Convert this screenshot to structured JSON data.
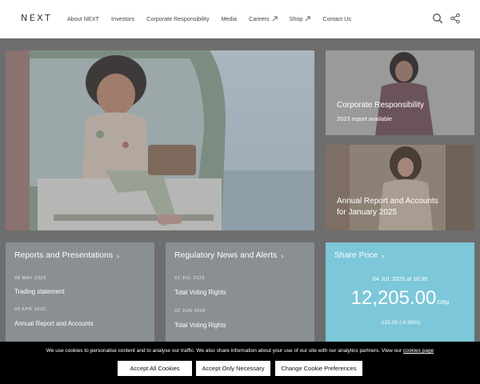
{
  "header": {
    "logo": "NEXT",
    "nav": [
      {
        "label": "About NEXT",
        "external": false
      },
      {
        "label": "Investors",
        "external": false
      },
      {
        "label": "Corporate Responsibility",
        "external": false
      },
      {
        "label": "Media",
        "external": false
      },
      {
        "label": "Careers",
        "external": true
      },
      {
        "label": "Shop",
        "external": true
      },
      {
        "label": "Contact Us",
        "external": false
      }
    ],
    "icons": [
      "search-icon",
      "share-icon"
    ]
  },
  "hero": {
    "image": "child-in-camper-van"
  },
  "corporate_responsibility": {
    "title": "Corporate Responsibility",
    "subtitle": "2023 report available"
  },
  "annual_report": {
    "title_line1": "Annual Report and Accounts",
    "title_line2": "for January 2025"
  },
  "reports": {
    "title": "Reports and Presentations",
    "items": [
      {
        "date": "08 MAY 2025",
        "label": "Trading statement"
      },
      {
        "date": "09 APR 2025",
        "label": "Annual Report and Accounts"
      }
    ]
  },
  "news": {
    "title": "Regulatory News and Alerts",
    "items": [
      {
        "date": "01 JUL 2025",
        "label": "Total Voting Rights"
      },
      {
        "date": "02 JUN 2025",
        "label": "Total Voting Rights"
      }
    ]
  },
  "share": {
    "title": "Share Price",
    "timestamp": "04 JUL 2025 at 16:36",
    "price": "12,205.00",
    "unit": "GBp",
    "change": "-115.00 (-0.93%)"
  },
  "cookie": {
    "text": "We use cookies to personalise content and to analyse our traffic. We also share information about your use of our site with our analytics partners. View our",
    "link": "cookies page",
    "buttons": [
      "Accept All Cookies",
      "Accept Only Necessary",
      "Change Cookie Preferences"
    ]
  },
  "colors": {
    "overlay": "#6e6e6e",
    "card_grey": "#8a8f94",
    "share_blue": "#7cc7d9"
  }
}
